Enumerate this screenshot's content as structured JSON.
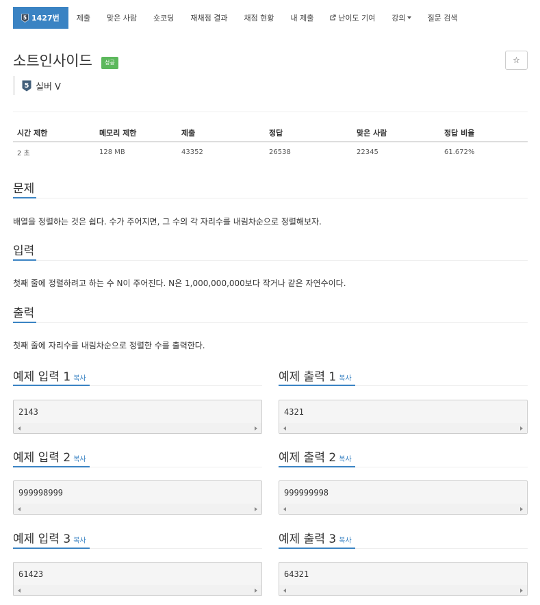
{
  "nav": {
    "problem_tab": "1427번",
    "tier_number": "5",
    "items": [
      "제출",
      "맞은 사람",
      "숏코딩",
      "재채점 결과",
      "채점 현황",
      "내 제출",
      "난이도 기여",
      "강의",
      "질문 검색"
    ]
  },
  "problem": {
    "title": "소트인사이드",
    "result_label": "성공",
    "tier_number": "5",
    "tier": "실버 V",
    "star_icon": "☆"
  },
  "stats": {
    "headers": [
      "시간 제한",
      "메모리 제한",
      "제출",
      "정답",
      "맞은 사람",
      "정답 비율"
    ],
    "values": [
      "2 초",
      "128 MB",
      "43352",
      "26538",
      "22345",
      "61.672%"
    ]
  },
  "sections": {
    "problem_title": "문제",
    "problem_text": "배열을 정렬하는 것은 쉽다. 수가 주어지면, 그 수의 각 자리수를 내림차순으로 정렬해보자.",
    "input_title": "입력",
    "input_text": "첫째 줄에 정렬하려고 하는 수 N이 주어진다. N은 1,000,000,000보다 작거나 같은 자연수이다.",
    "output_title": "출력",
    "output_text": "첫째 줄에 자리수를 내림차순으로 정렬한 수를 출력한다."
  },
  "samples": [
    {
      "input_title": "예제 입력 1",
      "output_title": "예제 출력 1",
      "input": "2143",
      "output": "4321"
    },
    {
      "input_title": "예제 입력 2",
      "output_title": "예제 출력 2",
      "input": "999998999",
      "output": "999999998"
    },
    {
      "input_title": "예제 입력 3",
      "output_title": "예제 출력 3",
      "input": "61423",
      "output": "64321"
    }
  ],
  "copy_label": "복사",
  "colors": {
    "accent": "#3a83c3",
    "success": "#5cb85c"
  }
}
